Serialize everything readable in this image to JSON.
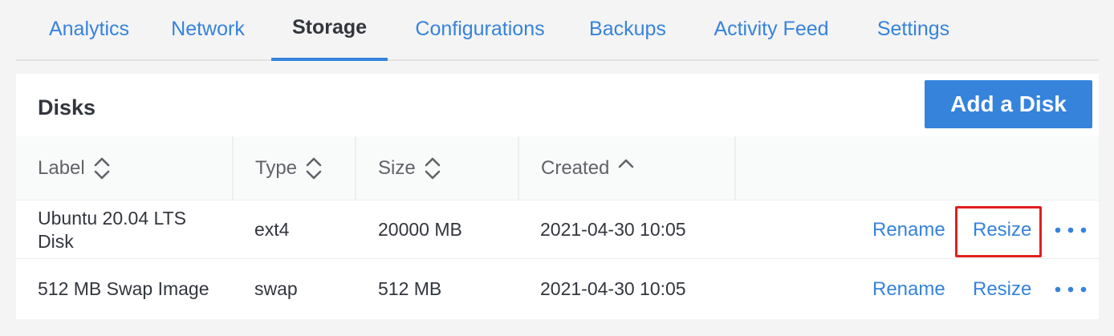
{
  "tabs": [
    {
      "label": "Analytics"
    },
    {
      "label": "Network"
    },
    {
      "label": "Storage"
    },
    {
      "label": "Configurations"
    },
    {
      "label": "Backups"
    },
    {
      "label": "Activity Feed"
    },
    {
      "label": "Settings"
    }
  ],
  "active_tab": "Storage",
  "panel": {
    "title": "Disks",
    "add_button": "Add a Disk"
  },
  "table": {
    "columns": [
      {
        "label": "Label",
        "sort": "both"
      },
      {
        "label": "Type",
        "sort": "both"
      },
      {
        "label": "Size",
        "sort": "both"
      },
      {
        "label": "Created",
        "sort": "ascending"
      }
    ],
    "rows": [
      {
        "label": "Ubuntu 20.04 LTS Disk",
        "type": "ext4",
        "size": "20000 MB",
        "created": "2021-04-30 10:05",
        "rename": "Rename",
        "resize": "Resize"
      },
      {
        "label": "512 MB Swap Image",
        "type": "swap",
        "size": "512 MB",
        "created": "2021-04-30 10:05",
        "rename": "Rename",
        "resize": "Resize"
      }
    ]
  },
  "colors": {
    "accent": "#3683dc",
    "text": "#32363c",
    "header_text": "#606469",
    "highlight": "#e02020"
  },
  "icons": {
    "sort_both": "sort-icon",
    "sort_asc": "sort-ascending-icon",
    "more": "more-actions-icon"
  }
}
